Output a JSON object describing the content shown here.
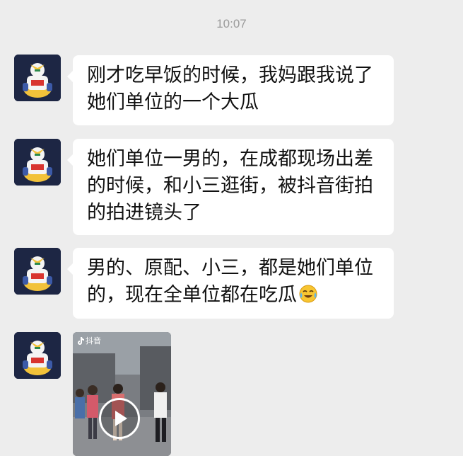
{
  "timestamp": "10:07",
  "messages": [
    {
      "sender_avatar": "gundam-figure-avatar",
      "lines": [
        "刚才吃早饭的时候，我妈跟我说了",
        "她们单位的一个大瓜"
      ]
    },
    {
      "sender_avatar": "gundam-figure-avatar",
      "lines": [
        "她们单位一男的，在成都现场出差",
        "的时候，和小三逛街，被抖音街拍",
        "的拍进镜头了"
      ]
    },
    {
      "sender_avatar": "gundam-figure-avatar",
      "lines": [
        "男的、原配、小三，都是她们单位",
        "的，现在全单位都在吃瓜"
      ],
      "trailing_emoji": "crying-laughing-emoji"
    },
    {
      "sender_avatar": "gundam-figure-avatar",
      "type": "video",
      "badge_text": "抖音",
      "play_icon": "play-icon"
    }
  ],
  "colors": {
    "background": "#ededed",
    "bubble": "#ffffff",
    "timestamp": "#9a9a9a",
    "text": "#111111"
  }
}
